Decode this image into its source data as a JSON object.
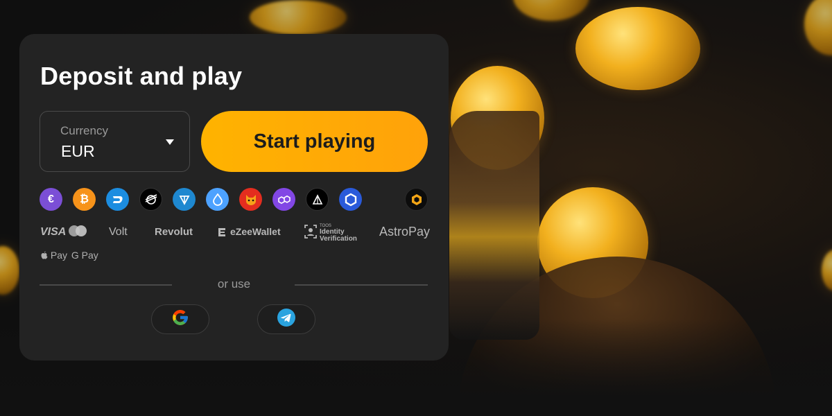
{
  "deposit": {
    "title": "Deposit and play",
    "currency_label": "Currency",
    "currency_value": "EUR",
    "start_button": "Start playing"
  },
  "crypto_icons": [
    {
      "name": "euro-icon",
      "glyph": "€",
      "color": "#7b4fd6"
    },
    {
      "name": "bitcoin-icon",
      "glyph": "₿",
      "color": "#f7931a"
    },
    {
      "name": "dash-icon",
      "glyph": "D",
      "color": "#1c8de0"
    },
    {
      "name": "stellar-icon",
      "glyph": "",
      "color": "#000000"
    },
    {
      "name": "ton-icon",
      "glyph": "",
      "color": "#1e88d0"
    },
    {
      "name": "sui-icon",
      "glyph": "",
      "color": "#4da2ff"
    },
    {
      "name": "shiba-icon",
      "glyph": "",
      "color": "#e42d1f"
    },
    {
      "name": "polygon-icon",
      "glyph": "",
      "color": "#8247e5"
    },
    {
      "name": "tron-icon",
      "glyph": "",
      "color": "#000000"
    },
    {
      "name": "chainlink-icon",
      "glyph": "",
      "color": "#2a5ada"
    },
    {
      "name": "more-crypto-icon",
      "glyph": "",
      "color": "#0c0c0c"
    }
  ],
  "payment_methods": {
    "visa": "VISA",
    "volt": "Volt",
    "revolut": "Revolut",
    "ezeewallet": "eZeeWallet",
    "identity_small": "TOOS",
    "identity_line1": "Identity",
    "identity_line2": "Verification",
    "astropay": "AstroPay",
    "apple_pay": "Pay",
    "google_pay": "G Pay"
  },
  "divider_text": "or use"
}
